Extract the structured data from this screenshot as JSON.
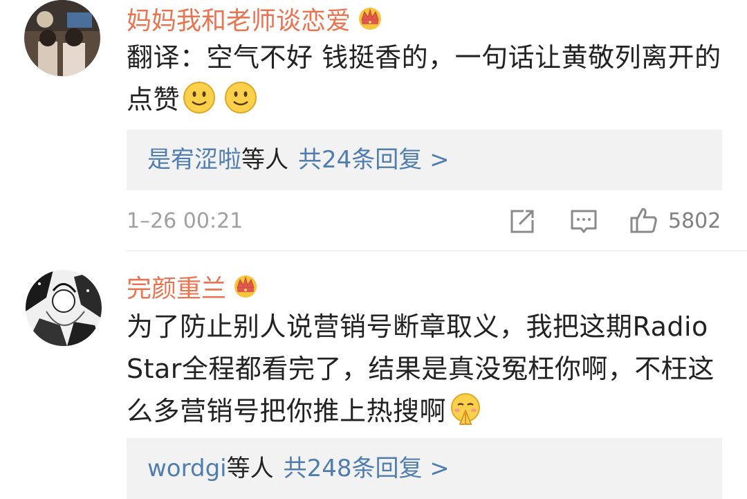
{
  "comments": [
    {
      "username": "妈妈我和老师谈恋爱",
      "text": "翻译：空气不好  钱挺香的，一句话让黄敬列离开的点赞",
      "reply_users": "是宥涩啦",
      "reply_mid": "等人",
      "reply_count": "共24条回复 >",
      "timestamp": "1–26 00:21",
      "likes": "5802"
    },
    {
      "username": "完颜重兰",
      "text": "为了防止别人说营销号断章取义，我把这期Radio Star全程都看完了，结果是真没冤枉你啊，不枉这么多营销号把你推上热搜啊",
      "reply_users": "wordgi",
      "reply_mid": "等人",
      "reply_count": "共248条回复 >"
    }
  ],
  "icons": {
    "vip_badge": "crown-icon",
    "share": "share-icon",
    "comment": "comment-icon",
    "like": "thumbs-up-icon",
    "emoji_smile": "smile-emoji",
    "emoji_pray": "pray-emoji"
  },
  "colors": {
    "username": "#eb7350",
    "link": "#507daf",
    "text": "#222222",
    "meta": "#a0a0a0",
    "reply_bg": "#f2f2f2"
  }
}
